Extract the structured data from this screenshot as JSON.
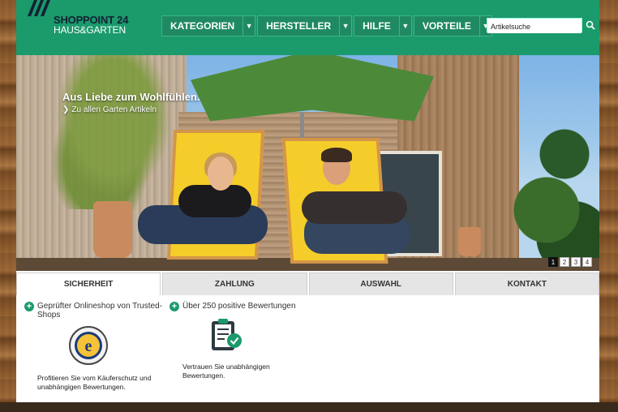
{
  "logo": {
    "line1": "SHOPPOINT 24",
    "line2": "HAUS&GARTEN"
  },
  "nav": {
    "items": [
      {
        "label": "KATEGORIEN"
      },
      {
        "label": "HERSTELLER"
      },
      {
        "label": "HILFE"
      },
      {
        "label": "VORTEILE"
      }
    ]
  },
  "search": {
    "value": "Artikelsuche"
  },
  "hero": {
    "title": "Aus Liebe zum Wohlfühlen.",
    "link": "Zu allen Garten Artikeln",
    "pages": [
      "1",
      "2",
      "3",
      "4"
    ],
    "active_page": "1"
  },
  "tabs": [
    {
      "label": "SICHERHEIT"
    },
    {
      "label": "ZAHLUNG"
    },
    {
      "label": "AUSWAHL"
    },
    {
      "label": "KONTAKT"
    }
  ],
  "features": [
    {
      "heading": "Geprüfter Onlineshop von Trusted-Shops",
      "text": "Profitieren Sie vom Käuferschutz und unabhängigen Bewertungen."
    },
    {
      "heading": "Über 250 positive Bewertungen",
      "text": "Vertrauen Sie unabhängigen Bewertungen."
    }
  ],
  "colors": {
    "brand_green": "#1b9a6c",
    "tab_bg": "#e5e5e5"
  }
}
